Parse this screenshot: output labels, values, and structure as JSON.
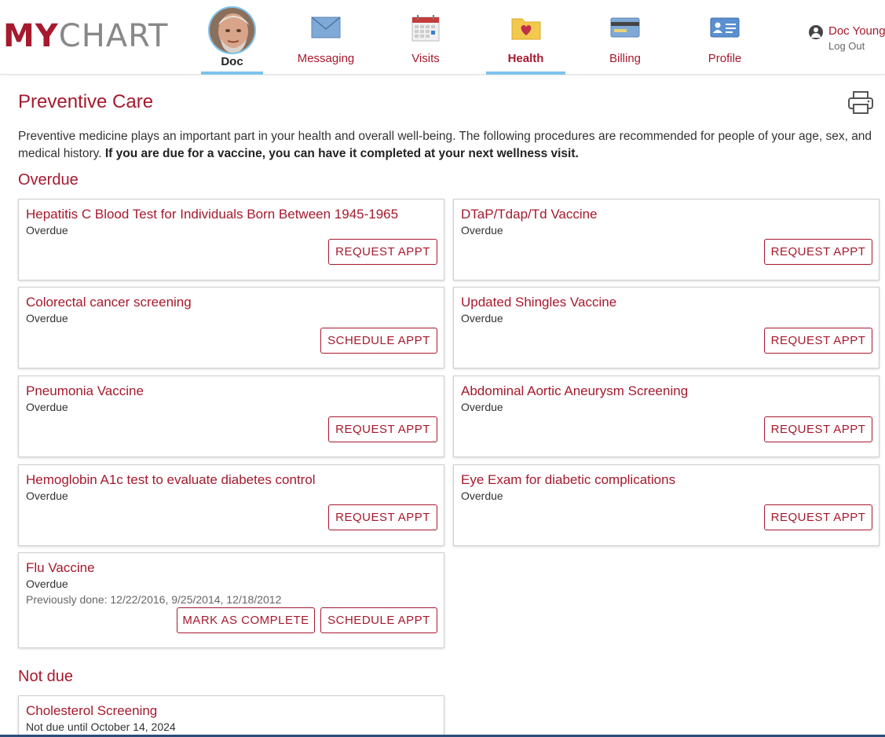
{
  "brand": {
    "my": "MY",
    "chart": "CHART"
  },
  "patient": {
    "name": "Doc"
  },
  "nav": [
    {
      "label": "Messaging",
      "icon": "envelope-icon"
    },
    {
      "label": "Visits",
      "icon": "calendar-icon"
    },
    {
      "label": "Health",
      "icon": "folder-heart-icon",
      "active": true
    },
    {
      "label": "Billing",
      "icon": "credit-card-icon"
    },
    {
      "label": "Profile",
      "icon": "id-card-icon"
    }
  ],
  "user": {
    "name": "Doc Young",
    "logout": "Log Out"
  },
  "page": {
    "title": "Preventive Care",
    "intro_text": "Preventive medicine plays an important part in your health and overall well-being. The following procedures are recommended for people of your age, sex, and medical history.",
    "intro_bold": "If you are due for a vaccine, you can have it completed at your next wellness visit."
  },
  "overdue": {
    "heading": "Overdue",
    "cards": [
      {
        "title": "Hepatitis C Blood Test for Individuals Born Between 1945-1965",
        "status": "Overdue",
        "button": "REQUEST APPT"
      },
      {
        "title": "DTaP/Tdap/Td Vaccine",
        "status": "Overdue",
        "button": "REQUEST APPT"
      },
      {
        "title": "Colorectal cancer screening",
        "status": "Overdue",
        "button": "SCHEDULE APPT"
      },
      {
        "title": "Updated Shingles Vaccine",
        "status": "Overdue",
        "button": "REQUEST APPT"
      },
      {
        "title": "Pneumonia Vaccine",
        "status": "Overdue",
        "button": "REQUEST APPT"
      },
      {
        "title": "Abdominal Aortic Aneurysm Screening",
        "status": "Overdue",
        "button": "REQUEST APPT"
      },
      {
        "title": "Hemoglobin A1c test to evaluate diabetes control",
        "status": "Overdue",
        "button": "REQUEST APPT"
      },
      {
        "title": "Eye Exam for diabetic complications",
        "status": "Overdue",
        "button": "REQUEST APPT"
      },
      {
        "title": "Flu Vaccine",
        "status": "Overdue",
        "previous": "Previously done: 12/22/2016, 9/25/2014, 12/18/2012",
        "button2": "MARK AS COMPLETE",
        "button": "SCHEDULE APPT"
      }
    ]
  },
  "not_due": {
    "heading": "Not due",
    "cards": [
      {
        "title": "Cholesterol Screening",
        "status": "Not due until October 14, 2024"
      }
    ]
  },
  "colors": {
    "brand": "#a6192e",
    "accent": "#7cc3ec",
    "footer": "#2b4d7a"
  }
}
